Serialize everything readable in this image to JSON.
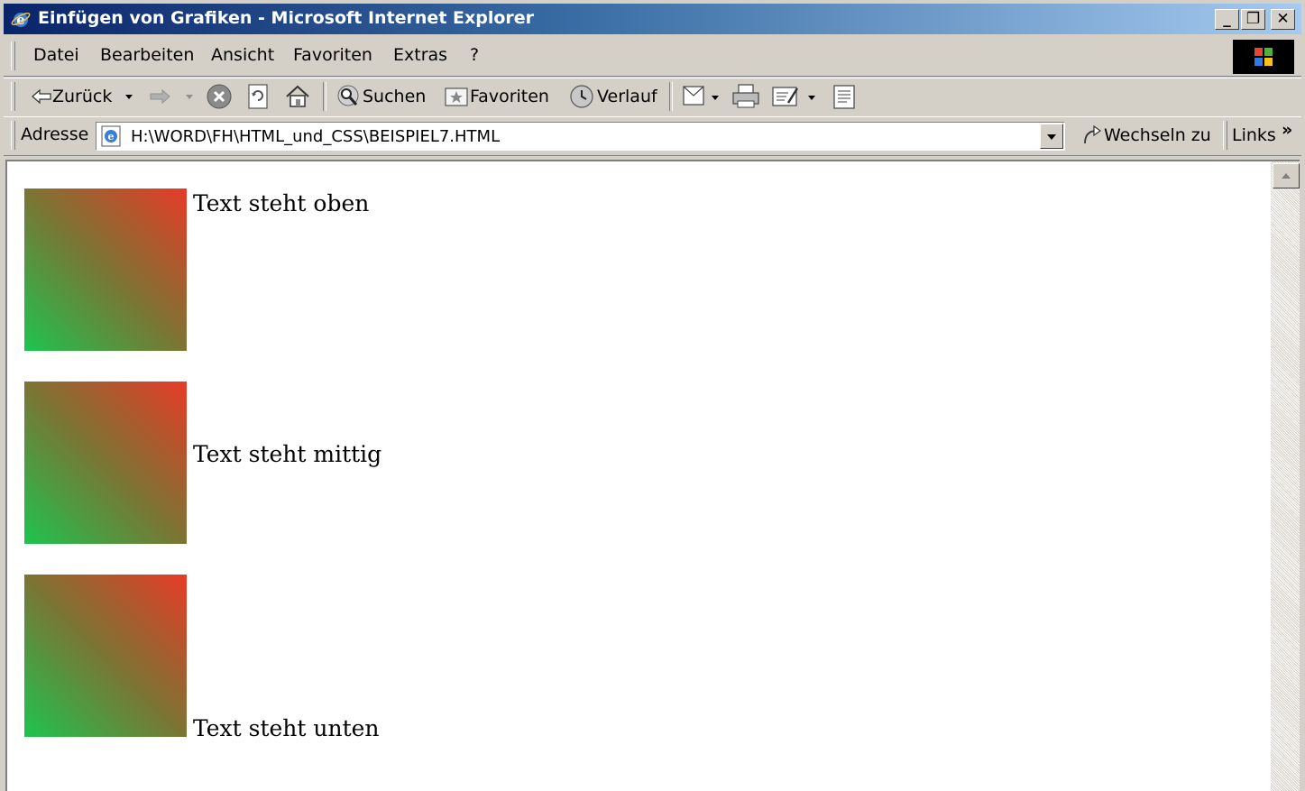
{
  "window": {
    "title": "Einfügen von Grafiken - Microsoft Internet Explorer",
    "minimize": "_",
    "maximize": "❐",
    "close": "✕"
  },
  "menu": {
    "items": [
      "Datei",
      "Bearbeiten",
      "Ansicht",
      "Favoriten",
      "Extras",
      "?"
    ]
  },
  "toolbar": {
    "back_label": "Zurück",
    "search_label": "Suchen",
    "favorites_label": "Favoriten",
    "history_label": "Verlauf"
  },
  "address": {
    "label": "Adresse",
    "value": "H:\\WORD\\FH\\HTML_und_CSS\\BEISPIEL7.HTML",
    "go_label": "Wechseln zu",
    "links_label": "Links",
    "more": "»"
  },
  "content": {
    "text_top": "Text steht oben",
    "text_middle": "Text steht mittig",
    "text_bottom": "Text steht unten"
  },
  "colors": {
    "title_start": "#0a246a",
    "title_end": "#a6caf0",
    "image_green": "#1ec44f",
    "image_red": "#e63b28"
  }
}
